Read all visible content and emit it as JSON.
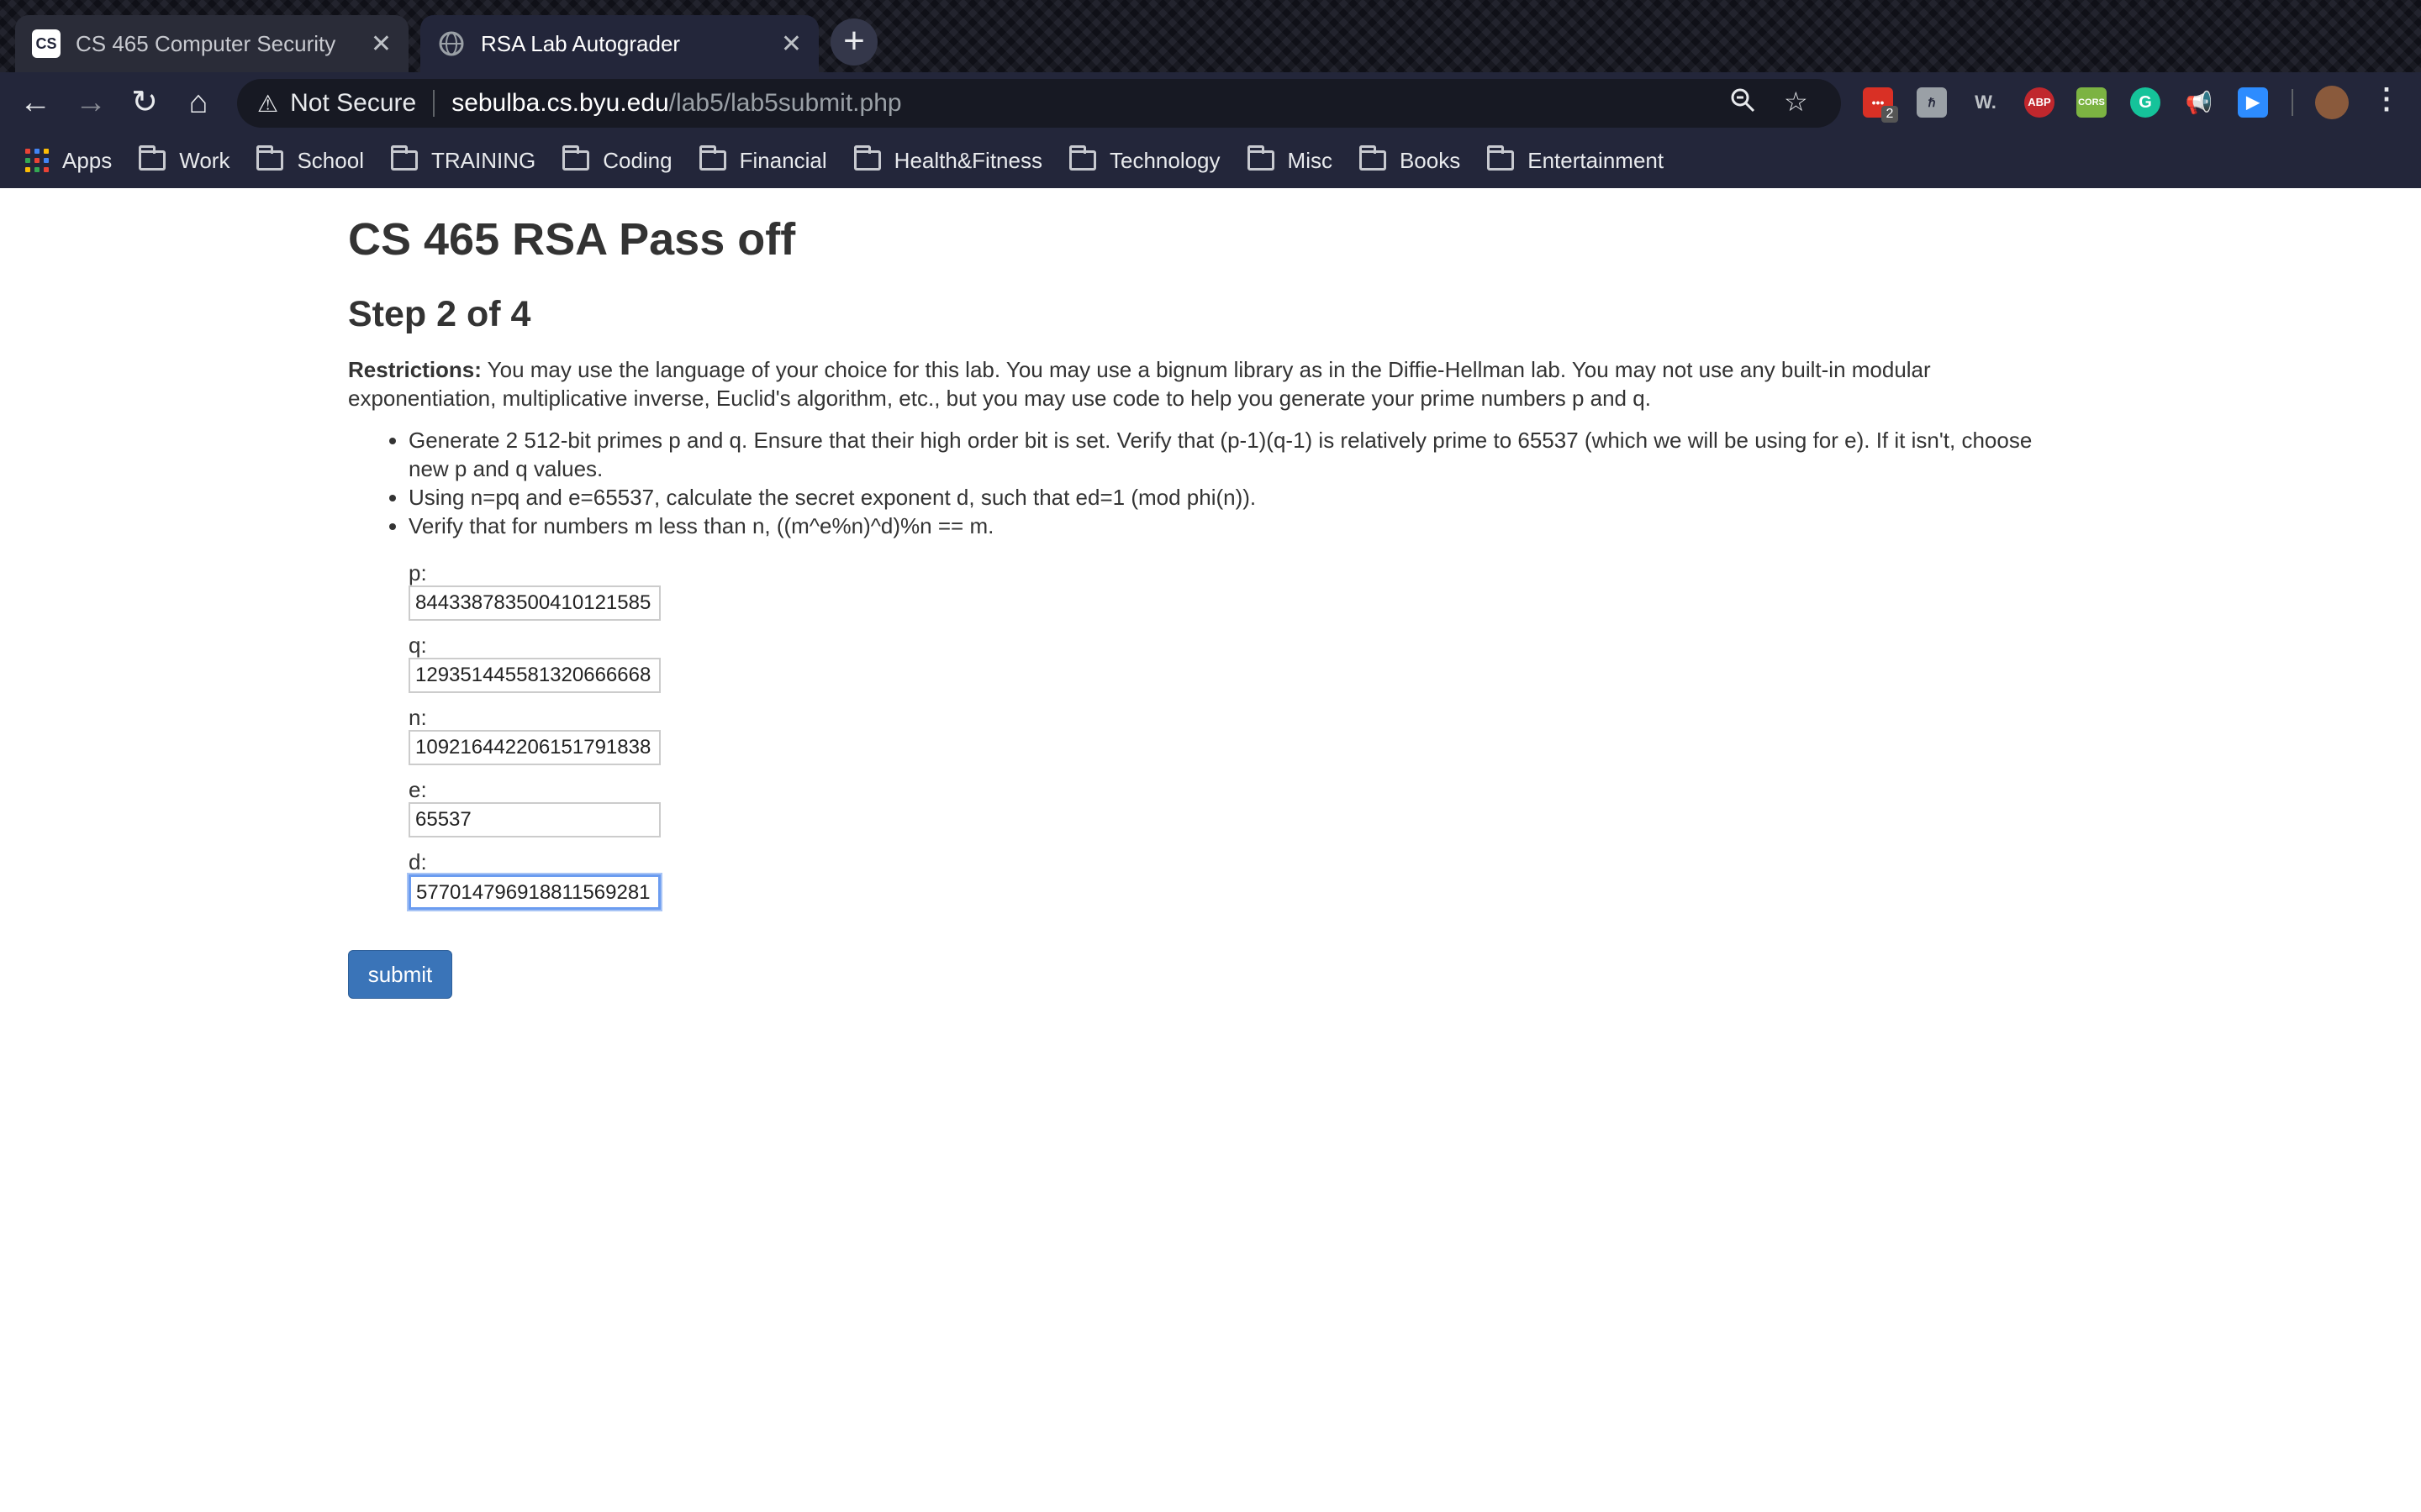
{
  "browser": {
    "tabs": [
      {
        "title": "CS 465 Computer Security",
        "favicon": "cs-favicon"
      },
      {
        "title": "RSA Lab Autograder",
        "favicon": "globe-icon"
      }
    ],
    "security_label": "Not Secure",
    "url_host": "sebulba.cs.byu.edu",
    "url_path": "/lab5/lab5submit.php",
    "extension_badge": "2",
    "ext_abp": "ABP",
    "ext_cors": "CORS",
    "ext_w": "W.",
    "bookmarks": [
      "Apps",
      "Work",
      "School",
      "TRAINING",
      "Coding",
      "Financial",
      "Health&Fitness",
      "Technology",
      "Misc",
      "Books",
      "Entertainment"
    ]
  },
  "page": {
    "title": "CS 465 RSA Pass off",
    "step": "Step 2 of 4",
    "restrictions_label": "Restrictions:",
    "restrictions_text": " You may use the language of your choice for this lab. You may use a bignum library as in the Diffie-Hellman lab. You may not use any built-in modular exponentiation, multiplicative inverse, Euclid's algorithm, etc., but you may use code to help you generate your prime numbers p and q.",
    "bullets": [
      "Generate 2 512-bit primes p and q. Ensure that their high order bit is set. Verify that (p-1)(q-1) is relatively prime to 65537 (which we will be using for e). If it isn't, choose new p and q values.",
      "Using n=pq and e=65537, calculate the secret exponent d, such that ed=1 (mod phi(n)).",
      "Verify that for numbers m less than n, ((m^e%n)^d)%n == m."
    ],
    "fields": [
      {
        "label": "p:",
        "value": "8443387835004101215​85"
      },
      {
        "label": "q:",
        "value": "12935144558132066666​8"
      },
      {
        "label": "n:",
        "value": "10921644220615179183​8"
      },
      {
        "label": "e:",
        "value": "65537"
      },
      {
        "label": "d:",
        "value": "577014796918811569281"
      }
    ],
    "submit_label": "submit"
  },
  "colors": {
    "accent": "#3a74b8",
    "focus": "#6b9cf0",
    "chrome_bg": "#23263a"
  }
}
